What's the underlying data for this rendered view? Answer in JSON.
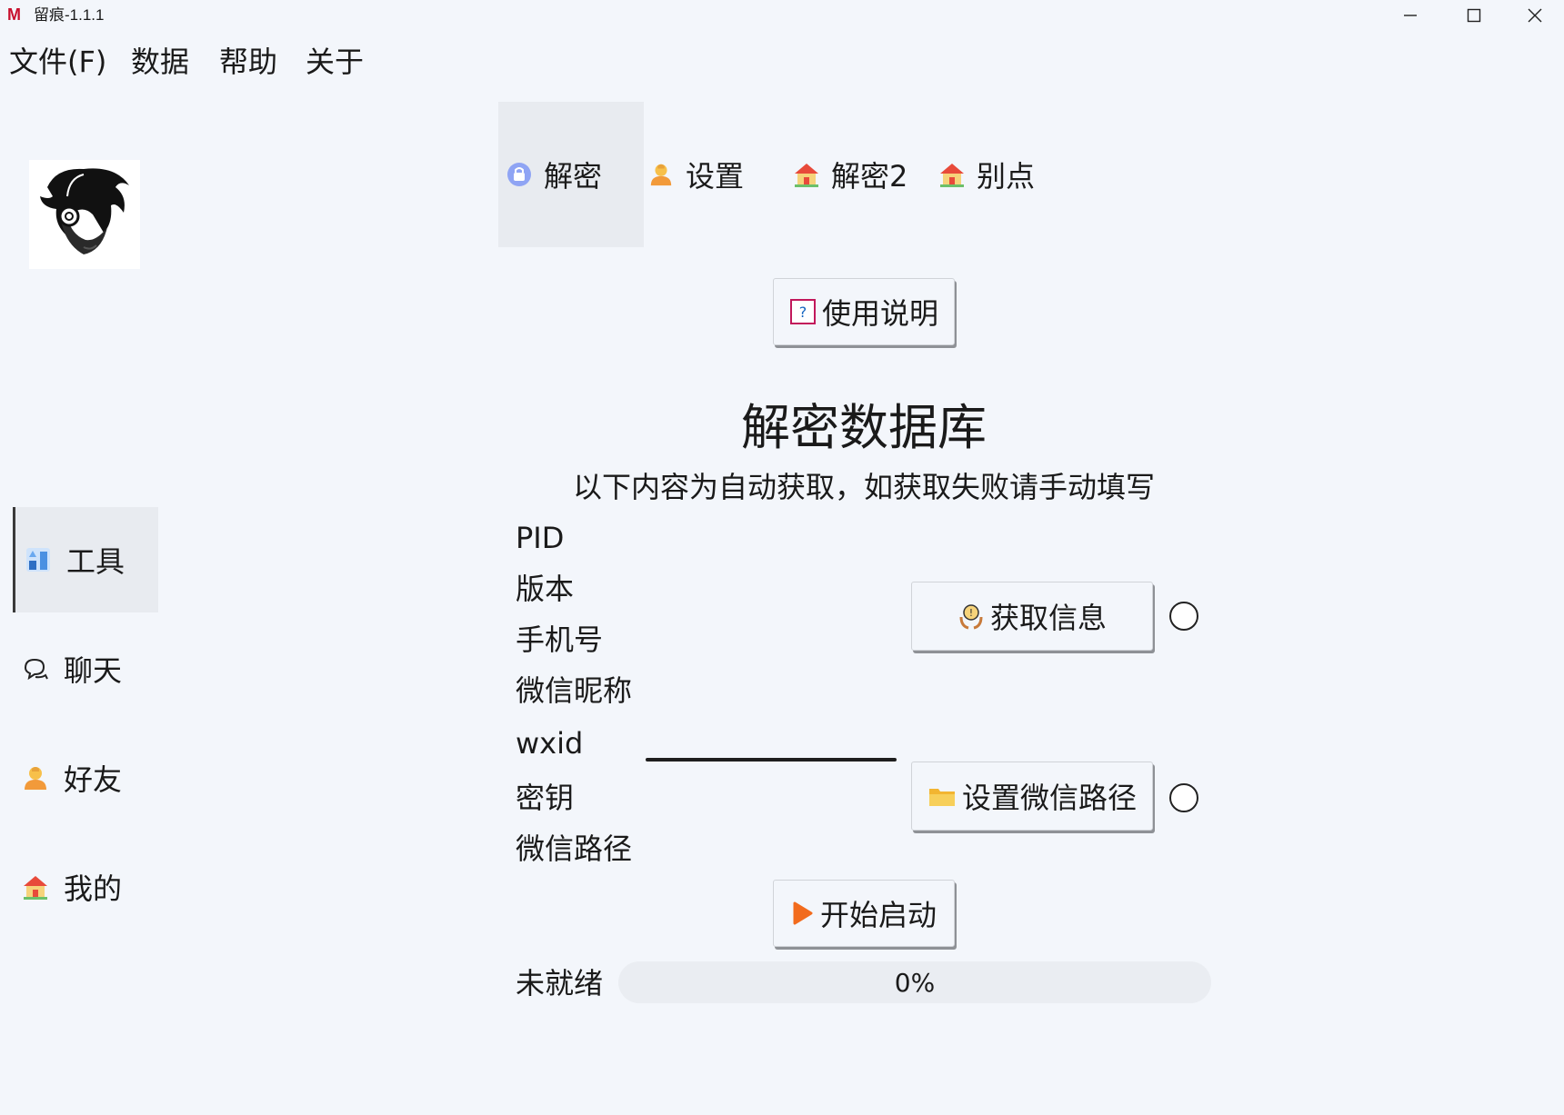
{
  "window": {
    "title": "留痕-1.1.1",
    "logo_letter": "M"
  },
  "menu": {
    "file": "文件(F)",
    "data": "数据",
    "help": "帮助",
    "about": "关于"
  },
  "nav": [
    {
      "label": "工具",
      "icon": "tools-icon"
    },
    {
      "label": "聊天",
      "icon": "chat-icon"
    },
    {
      "label": "好友",
      "icon": "person-icon"
    },
    {
      "label": "我的",
      "icon": "house-icon"
    }
  ],
  "tabs": [
    {
      "label": "解密",
      "icon": "lock-icon"
    },
    {
      "label": "设置",
      "icon": "person-icon"
    },
    {
      "label": "解密2",
      "icon": "house-icon"
    },
    {
      "label": "别点",
      "icon": "house-icon"
    }
  ],
  "help_button": "使用说明",
  "main": {
    "title": "解密数据库",
    "subtitle": "以下内容为自动获取，如获取失败请手动填写"
  },
  "fields": {
    "pid": "PID",
    "version": "版本",
    "phone": "手机号",
    "nickname": "微信昵称",
    "wxid": "wxid",
    "key": "密钥",
    "path": "微信路径"
  },
  "buttons": {
    "get_info": "获取信息",
    "set_path": "设置微信路径",
    "start": "开始启动"
  },
  "status": {
    "label": "未就绪",
    "progress": 0,
    "progress_text": "0%"
  },
  "colors": {
    "accent": "#3b82f6",
    "background": "#f3f6fb",
    "logo": "#c8102e"
  }
}
